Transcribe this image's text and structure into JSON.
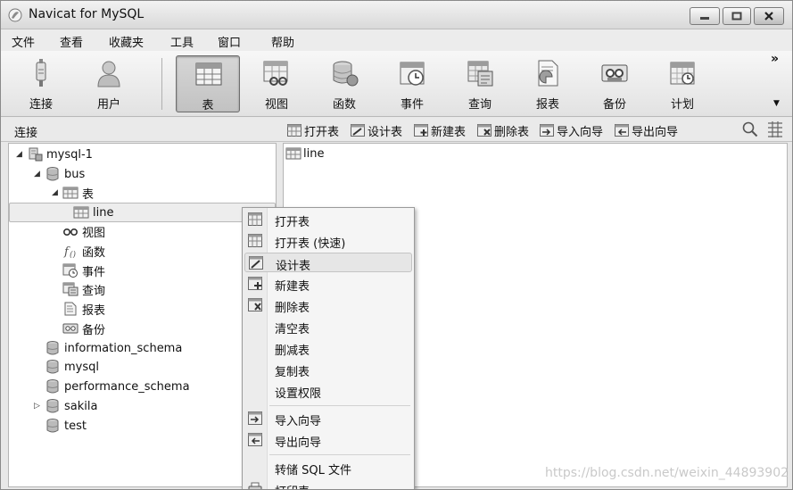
{
  "window": {
    "title": "Navicat for MySQL"
  },
  "menu": [
    "文件",
    "查看",
    "收藏夹",
    "工具",
    "窗口",
    "帮助"
  ],
  "toolbar": {
    "buttons": [
      {
        "label": "连接",
        "icon": "connection-icon"
      },
      {
        "label": "用户",
        "icon": "user-icon"
      },
      {
        "label": "表",
        "icon": "table-icon",
        "active": true
      },
      {
        "label": "视图",
        "icon": "view-icon"
      },
      {
        "label": "函数",
        "icon": "function-icon"
      },
      {
        "label": "事件",
        "icon": "event-icon"
      },
      {
        "label": "查询",
        "icon": "query-icon"
      },
      {
        "label": "报表",
        "icon": "report-icon"
      },
      {
        "label": "备份",
        "icon": "backup-icon"
      },
      {
        "label": "计划",
        "icon": "schedule-icon"
      }
    ],
    "more": "»"
  },
  "subbar": {
    "connection_label": "连接",
    "actions": [
      "打开表",
      "设计表",
      "新建表",
      "删除表",
      "导入向导",
      "导出向导"
    ]
  },
  "tree": [
    {
      "label": "mysql-1",
      "level": 0,
      "arrow": "◢",
      "icon": "server-icon"
    },
    {
      "label": "bus",
      "level": 1,
      "arrow": "◢",
      "icon": "database-icon"
    },
    {
      "label": "表",
      "level": 2,
      "arrow": "◢",
      "icon": "table-icon"
    },
    {
      "label": "line",
      "level": 3,
      "arrow": "",
      "icon": "table-icon",
      "selected": true
    },
    {
      "label": "视图",
      "level": 2,
      "arrow": "",
      "icon": "view-icon"
    },
    {
      "label": "函数",
      "level": 2,
      "arrow": "",
      "icon": "function-icon"
    },
    {
      "label": "事件",
      "level": 2,
      "arrow": "",
      "icon": "event-icon"
    },
    {
      "label": "查询",
      "level": 2,
      "arrow": "",
      "icon": "query-icon"
    },
    {
      "label": "报表",
      "level": 2,
      "arrow": "",
      "icon": "report-icon"
    },
    {
      "label": "备份",
      "level": 2,
      "arrow": "",
      "icon": "backup-icon"
    },
    {
      "label": "information_schema",
      "level": 1,
      "arrow": "",
      "icon": "database-icon"
    },
    {
      "label": "mysql",
      "level": 1,
      "arrow": "",
      "icon": "database-icon"
    },
    {
      "label": "performance_schema",
      "level": 1,
      "arrow": "",
      "icon": "database-icon"
    },
    {
      "label": "sakila",
      "level": 1,
      "arrow": "▷",
      "icon": "database-icon"
    },
    {
      "label": "test",
      "level": 1,
      "arrow": "",
      "icon": "database-icon"
    }
  ],
  "right_panel": {
    "items": [
      "line"
    ]
  },
  "context_menu": {
    "items": [
      {
        "label": "打开表",
        "icon": "open-table-icon"
      },
      {
        "label": "打开表 (快速)",
        "icon": "open-table-icon"
      },
      {
        "label": "设计表",
        "icon": "design-table-icon",
        "highlighted": true
      },
      {
        "label": "新建表",
        "icon": "new-table-icon"
      },
      {
        "label": "删除表",
        "icon": "delete-table-icon"
      },
      {
        "label": "清空表",
        "icon": ""
      },
      {
        "label": "删减表",
        "icon": ""
      },
      {
        "label": "复制表",
        "icon": ""
      },
      {
        "label": "设置权限",
        "icon": ""
      },
      {
        "label": "导入向导",
        "icon": "import-icon"
      },
      {
        "label": "导出向导",
        "icon": "export-icon"
      },
      {
        "label": "转储 SQL 文件",
        "icon": ""
      },
      {
        "label": "打印表",
        "icon": "print-icon"
      }
    ]
  },
  "watermark": "https://blog.csdn.net/weixin_44893902"
}
